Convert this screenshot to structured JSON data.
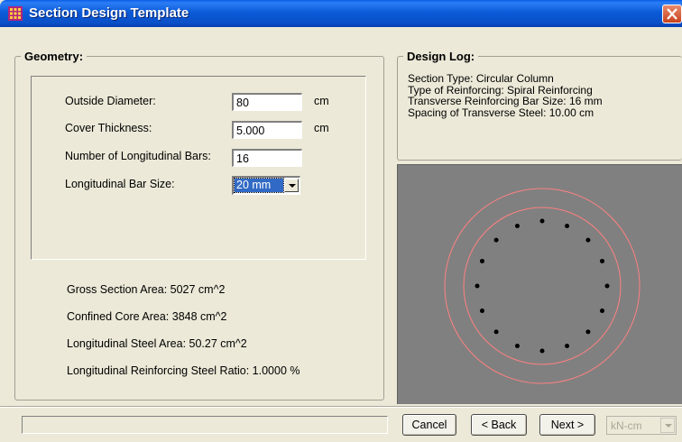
{
  "window": {
    "title": "Section Design Template"
  },
  "geometry": {
    "legend": "Geometry:",
    "outside_diameter": {
      "label": "Outside Diameter:",
      "value": "80",
      "unit": "cm"
    },
    "cover_thickness": {
      "label": "Cover Thickness:",
      "value": "5.000",
      "unit": "cm"
    },
    "num_bars": {
      "label": "Number of Longitudinal Bars:",
      "value": "16"
    },
    "bar_size": {
      "label": "Longitudinal Bar Size:",
      "value": "20 mm"
    },
    "results": {
      "gross_area": "Gross Section Area:  5027 cm^2",
      "core_area": "Confined Core Area:  3848 cm^2",
      "steel_area": "Longitudinal Steel Area:  50.27 cm^2",
      "steel_ratio": "Longitudinal Reinforcing Steel Ratio:  1.0000 %"
    }
  },
  "design_log": {
    "legend": "Design Log:",
    "lines": [
      "Section Type:  Circular Column",
      "Type of Reinforcing:  Spiral Reinforcing",
      "Transverse Reinforcing Bar Size:  16 mm",
      "Spacing of Transverse Steel:  10.00  cm"
    ]
  },
  "section_preview": {
    "bar_count": 16,
    "colors": {
      "background": "#808080",
      "outline": "#ff8080",
      "bars": "#000000"
    }
  },
  "footer": {
    "cancel": "Cancel",
    "back": "< Back",
    "next": "Next >",
    "units": "kN-cm"
  }
}
